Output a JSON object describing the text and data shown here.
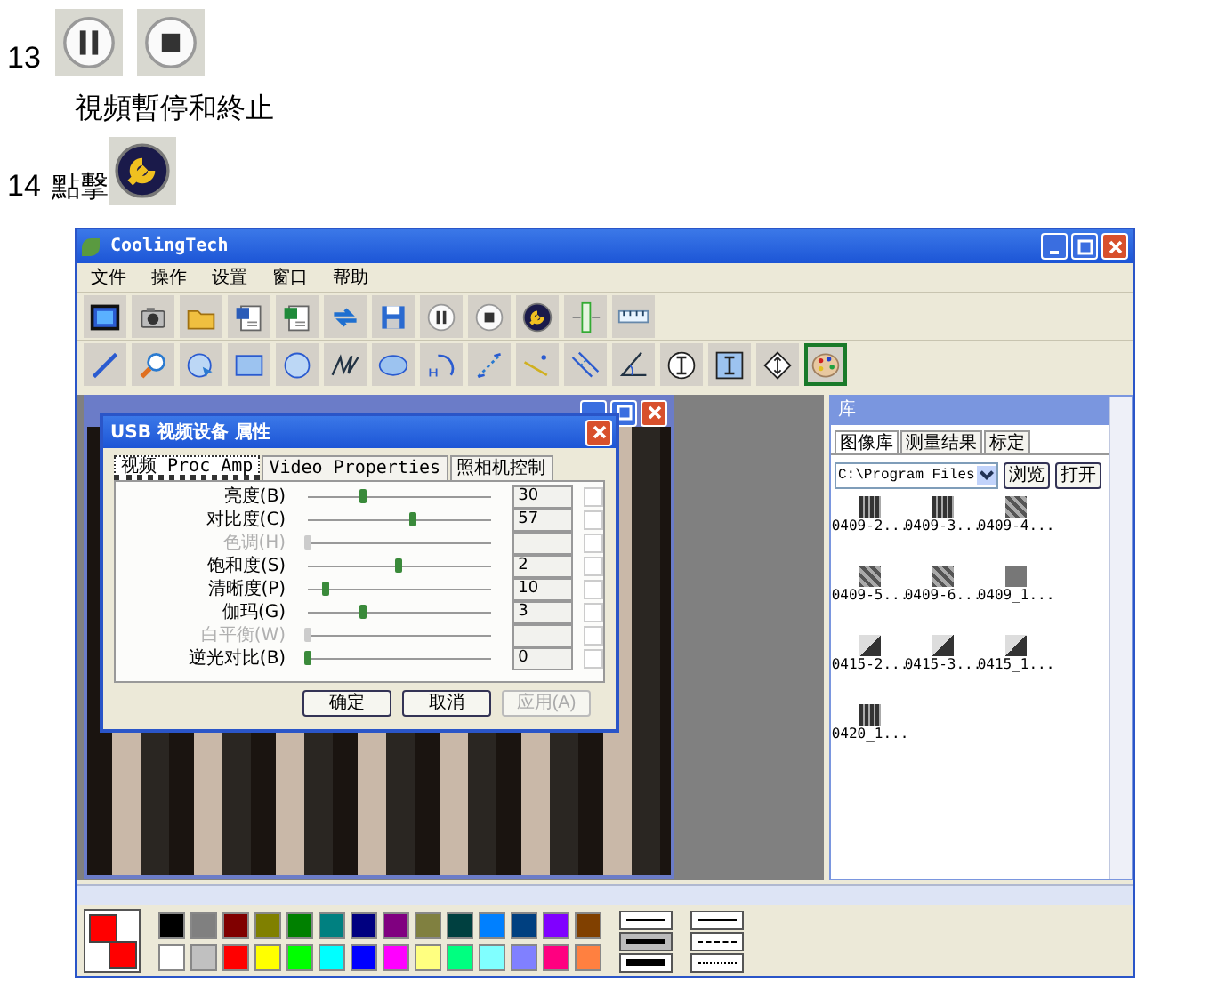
{
  "steps": {
    "pause_step": {
      "number": "13",
      "caption": "視頻暫停和終止"
    },
    "settings_step": {
      "number": "14",
      "label": "點擊"
    }
  },
  "app": {
    "title": "CoolingTech",
    "menu": [
      "文件",
      "操作",
      "设置",
      "窗口",
      "帮助"
    ],
    "tools": [
      {
        "kind": "line",
        "selected": false
      },
      {
        "kind": "zoom",
        "selected": false
      },
      {
        "kind": "circle",
        "selected": false
      },
      {
        "kind": "rect",
        "selected": false
      },
      {
        "kind": "octagon",
        "selected": false
      },
      {
        "kind": "polyline",
        "selected": false
      },
      {
        "kind": "ellipse",
        "selected": false
      },
      {
        "kind": "arc",
        "selected": false
      },
      {
        "kind": "distance",
        "selected": false
      },
      {
        "kind": "point",
        "selected": false
      },
      {
        "kind": "parallel",
        "selected": false
      },
      {
        "kind": "angle",
        "selected": false
      },
      {
        "kind": "ibeamcircle",
        "selected": false
      },
      {
        "kind": "ibeambox",
        "selected": false
      },
      {
        "kind": "diamond",
        "selected": false
      },
      {
        "kind": "palette",
        "selected": true
      }
    ],
    "dialog": {
      "title": "USB 视频设备 属性",
      "tabs": [
        {
          "label": "视频 Proc Amp",
          "selected": true
        },
        {
          "label": "Video Properties",
          "selected": false
        },
        {
          "label": "照相机控制",
          "selected": false
        }
      ],
      "controls": [
        {
          "label": "亮度(B)",
          "level": 0.3,
          "value": "30",
          "disabled": false,
          "checked": false
        },
        {
          "label": "对比度(C)",
          "level": 0.57,
          "value": "57",
          "disabled": false,
          "checked": false
        },
        {
          "label": "色调(H)",
          "level": 0,
          "disabled": true,
          "checked": false
        },
        {
          "label": "饱和度(S)",
          "level": 0.5,
          "value": "2",
          "disabled": false,
          "checked": false
        },
        {
          "label": "清晰度(P)",
          "level": 0.1,
          "value": "10",
          "disabled": false,
          "checked": false
        },
        {
          "label": "伽玛(G)",
          "level": 0.3,
          "value": "3",
          "disabled": false,
          "checked": false
        },
        {
          "label": "白平衡(W)",
          "level": 0,
          "disabled": true,
          "checked": false
        },
        {
          "label": "逆光对比(B)",
          "level": 0,
          "value": "0",
          "disabled": false,
          "checked": false
        }
      ],
      "buttons": [
        {
          "label": "确定",
          "disabled": false
        },
        {
          "label": "取消",
          "disabled": false
        },
        {
          "label": "应用(A)",
          "disabled": true
        }
      ]
    },
    "library": {
      "title": "库",
      "tabs": [
        {
          "label": "图像库",
          "selected": true
        },
        {
          "label": "测量结果",
          "selected": false
        },
        {
          "label": "标定",
          "selected": false
        }
      ],
      "path": "C:\\Program Files",
      "buttons": [
        "浏览",
        "打开"
      ],
      "thumbnails": [
        {
          "name": "0409-2...",
          "kind": "stripes"
        },
        {
          "name": "0409-3...",
          "kind": "stripes"
        },
        {
          "name": "0409-4...",
          "kind": "texture"
        },
        {
          "name": "0409-5...",
          "kind": "texture"
        },
        {
          "name": "0409-6...",
          "kind": "texture"
        },
        {
          "name": "0409_1...",
          "kind": "plain"
        },
        {
          "name": "0415-2...",
          "kind": "mark"
        },
        {
          "name": "0415-3...",
          "kind": "mark"
        },
        {
          "name": "0415_1...",
          "kind": "mark"
        },
        {
          "name": "0420_1...",
          "kind": "stripes"
        }
      ]
    },
    "current_colors": [
      {
        "color": "#ff0000"
      },
      {
        "color": "#ff0000"
      }
    ],
    "colors": [
      {
        "color": "#000000"
      },
      {
        "color": "#808080"
      },
      {
        "color": "#800000"
      },
      {
        "color": "#808000"
      },
      {
        "color": "#008000"
      },
      {
        "color": "#008080"
      },
      {
        "color": "#000080"
      },
      {
        "color": "#800080"
      },
      {
        "color": "#808040"
      },
      {
        "color": "#004040"
      },
      {
        "color": "#0080ff"
      },
      {
        "color": "#004080"
      },
      {
        "color": "#8000ff"
      },
      {
        "color": "#804000"
      },
      {
        "color": "#ffffff"
      },
      {
        "color": "#c0c0c0"
      },
      {
        "color": "#ff0000"
      },
      {
        "color": "#ffff00"
      },
      {
        "color": "#00ff00"
      },
      {
        "color": "#00ffff"
      },
      {
        "color": "#0000ff"
      },
      {
        "color": "#ff00ff"
      },
      {
        "color": "#ffff80"
      },
      {
        "color": "#00ff80"
      },
      {
        "color": "#80ffff"
      },
      {
        "color": "#8080ff"
      },
      {
        "color": "#ff0080"
      },
      {
        "color": "#ff8040"
      }
    ],
    "line_widths": [
      {
        "kind": "thin",
        "selected": false
      },
      {
        "kind": "medium",
        "selected": true
      },
      {
        "kind": "thick",
        "selected": false
      }
    ],
    "line_styles": [
      {
        "kind": "solid"
      },
      {
        "kind": "dashed"
      },
      {
        "kind": "dotted"
      }
    ]
  }
}
